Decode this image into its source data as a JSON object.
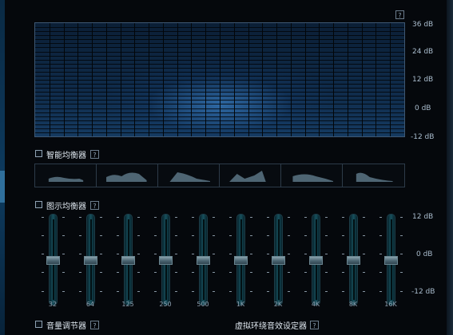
{
  "colors": {
    "background": "#05080c",
    "display_blue": "#1a5a9c",
    "knob": "#6b8590",
    "accent_edge": "#2f6f9c"
  },
  "icons": {
    "help": "question-mark-icon"
  },
  "help_glyph": "?",
  "spectrum": {
    "db_labels": [
      "36 dB",
      "24 dB",
      "12 dB",
      "0 dB",
      "-12 dB"
    ]
  },
  "smart_eq": {
    "label": "智能均衡器",
    "checked": false,
    "preset_count": 6
  },
  "graphic_eq": {
    "label": "图示均衡器",
    "checked": false,
    "scale_labels": [
      "12 dB",
      "0 dB",
      "-12 dB"
    ],
    "bands": [
      {
        "freq": "32",
        "gain_db": 0
      },
      {
        "freq": "64",
        "gain_db": 0
      },
      {
        "freq": "125",
        "gain_db": 0
      },
      {
        "freq": "250",
        "gain_db": 0
      },
      {
        "freq": "500",
        "gain_db": 0
      },
      {
        "freq": "1K",
        "gain_db": 0
      },
      {
        "freq": "2K",
        "gain_db": 0
      },
      {
        "freq": "4K",
        "gain_db": 0
      },
      {
        "freq": "8K",
        "gain_db": 0
      },
      {
        "freq": "16K",
        "gain_db": 0
      }
    ]
  },
  "volume_controller": {
    "label": "音量调节器",
    "checked": false
  },
  "virtual_surround": {
    "label": "虚拟环绕音效设定器"
  }
}
